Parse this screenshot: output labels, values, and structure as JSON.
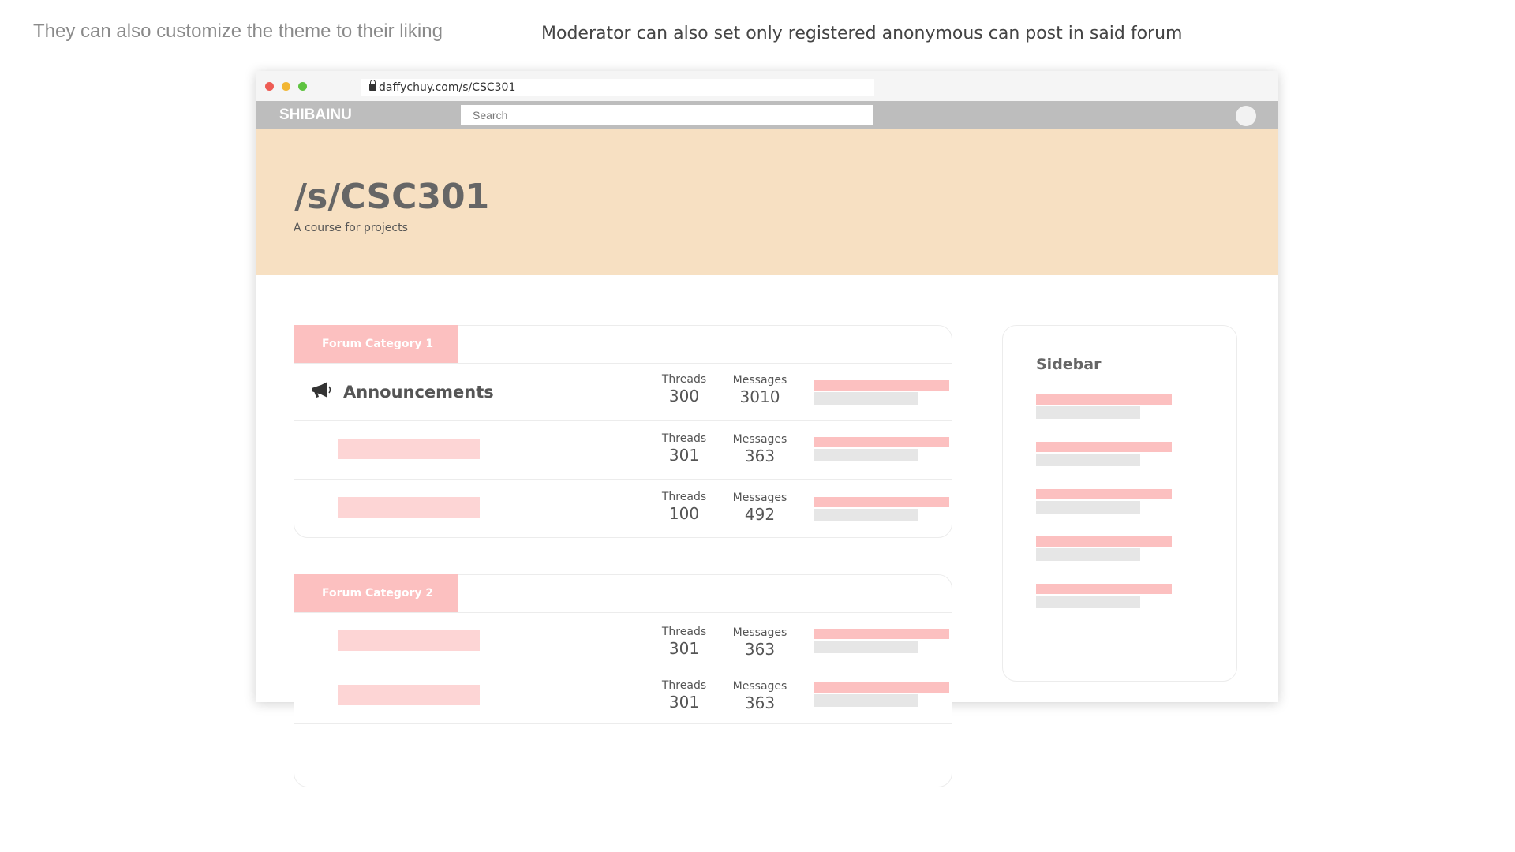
{
  "captions": {
    "left": "They can also customize the theme to their liking",
    "right": "Moderator can also set only registered anonymous can post in said forum"
  },
  "browser": {
    "url": "daffychuy.com/s/CSC301",
    "window_dots": [
      "#ee5c54",
      "#f2b632",
      "#5ec340"
    ]
  },
  "navbar": {
    "logo": "SHIBAINU",
    "search_placeholder": "Search",
    "background": "#bdbdbd"
  },
  "banner": {
    "title": "/s/CSC301",
    "subtitle": "A course for projects",
    "background": "#f7e0c2"
  },
  "theme": {
    "accent": "#fcc0c0",
    "placeholder": "#fdd5d5",
    "bar_gray": "#e6e6e6"
  },
  "categories": [
    {
      "label": "Forum Category 1",
      "rows": [
        {
          "title": "Announcements",
          "icon": "megaphone-icon",
          "threads_label": "Threads",
          "threads": "300",
          "messages_label": "Messages",
          "messages": "3010"
        },
        {
          "title": "",
          "threads_label": "Threads",
          "threads": "301",
          "messages_label": "Messages",
          "messages": "363"
        },
        {
          "title": "",
          "threads_label": "Threads",
          "threads": "100",
          "messages_label": "Messages",
          "messages": "492"
        }
      ]
    },
    {
      "label": "Forum Category 2",
      "rows": [
        {
          "title": "",
          "threads_label": "Threads",
          "threads": "301",
          "messages_label": "Messages",
          "messages": "363"
        },
        {
          "title": "",
          "threads_label": "Threads",
          "threads": "301",
          "messages_label": "Messages",
          "messages": "363"
        }
      ]
    }
  ],
  "sidebar": {
    "title": "Sidebar",
    "item_count": 5
  }
}
